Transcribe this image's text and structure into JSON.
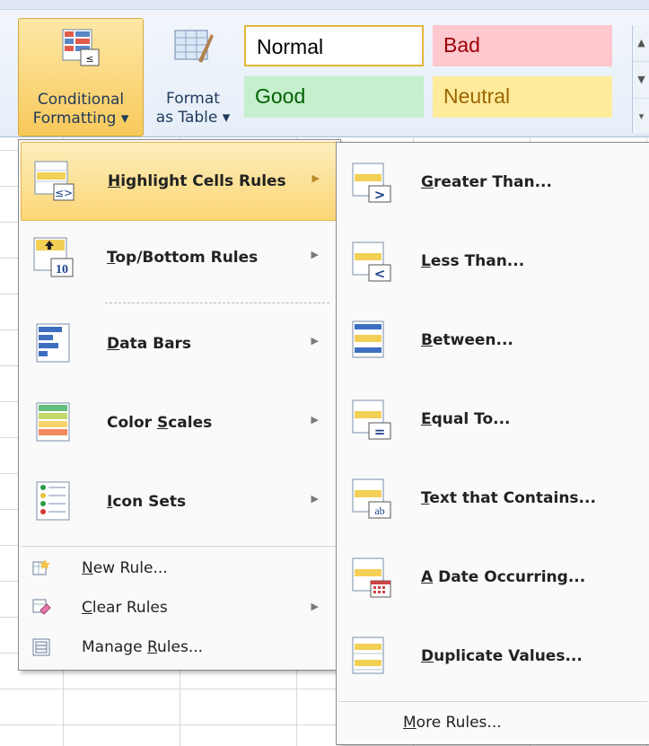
{
  "ribbon": {
    "conditional_formatting": {
      "line1": "Conditional",
      "line2": "Formatting ▾"
    },
    "format_as_table": {
      "line1": "Format",
      "line2": "as Table ▾"
    },
    "styles": {
      "normal": "Normal",
      "bad": "Bad",
      "good": "Good",
      "neutral": "Neutral"
    }
  },
  "menu": {
    "items": [
      {
        "pre": "",
        "key": "H",
        "post": "ighlight Cells Rules"
      },
      {
        "pre": "",
        "key": "T",
        "post": "op/Bottom Rules"
      },
      {
        "pre": "",
        "key": "D",
        "post": "ata Bars"
      },
      {
        "pre": "Color ",
        "key": "S",
        "post": "cales"
      },
      {
        "pre": "",
        "key": "I",
        "post": "con Sets"
      }
    ],
    "small_items": [
      {
        "pre": "",
        "key": "N",
        "post": "ew Rule..."
      },
      {
        "pre": "",
        "key": "C",
        "post": "lear Rules"
      },
      {
        "pre": "Manage ",
        "key": "R",
        "post": "ules..."
      }
    ]
  },
  "submenu": {
    "items": [
      {
        "pre": "",
        "key": "G",
        "post": "reater Than..."
      },
      {
        "pre": "",
        "key": "L",
        "post": "ess Than..."
      },
      {
        "pre": "",
        "key": "B",
        "post": "etween..."
      },
      {
        "pre": "",
        "key": "E",
        "post": "qual To..."
      },
      {
        "pre": "",
        "key": "T",
        "post": "ext that Contains..."
      },
      {
        "pre": "",
        "key": "A",
        "post": " Date Occurring..."
      },
      {
        "pre": "",
        "key": "D",
        "post": "uplicate Values..."
      }
    ],
    "more": {
      "pre": "",
      "key": "M",
      "post": "ore Rules..."
    }
  },
  "arrow_glyph": "▶",
  "colors": {
    "active_hover": "#fbd675",
    "bad_bg": "#ffc7ce",
    "good_bg": "#c6efce",
    "neutral_bg": "#ffeb9c"
  }
}
